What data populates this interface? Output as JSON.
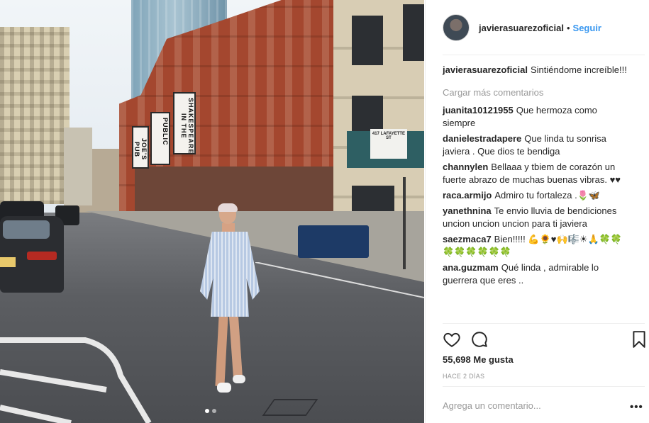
{
  "post": {
    "username": "javierasuarezoficial",
    "follow_label": "Seguir",
    "separator": "•",
    "caption": "Sintiéndome increíble!!!",
    "load_more": "Cargar más comentarios",
    "comments": [
      {
        "user": "juanita10121955",
        "text": "Que hermoza como siempre"
      },
      {
        "user": "danielestradapere",
        "text": "Que linda tu sonrisa javiera . Que dios te bendiga"
      },
      {
        "user": "channylen",
        "text": "Bellaaa y tbiem de corazón un fuerte abrazo de muchas buenas vibras. ♥♥"
      },
      {
        "user": "raca.armijo",
        "text": "Admiro tu fortaleza .🌷🦋"
      },
      {
        "user": "yanethnina",
        "text": "Te envio lluvia de bendiciones uncion uncion uncion para ti javiera"
      },
      {
        "user": "saezmaca7",
        "text": "Bien!!!!! 💪🌻♥🙌🎼☀🙏🍀🍀🍀🍀🍀🍀🍀🍀"
      },
      {
        "user": "ana.guzmam",
        "text": "Qué linda , admirable lo guerrera que eres .."
      }
    ],
    "likes": "55,698 Me gusta",
    "date": "HACE 2 DÍAS",
    "add_comment_placeholder": "Agrega un comentario...",
    "more_options": "•••"
  },
  "photo": {
    "banners": [
      "PUBLIC",
      "SHAKESPEARE IN THE",
      "JOE'S PUB"
    ],
    "street_sign": "417 LAFAYETTE ST",
    "carousel_dots": 2,
    "carousel_active": 0
  },
  "colors": {
    "accent": "#3897f0",
    "muted": "#999999",
    "text": "#262626",
    "border": "#efefef"
  },
  "icons": {
    "like": "heart-icon",
    "comment": "speech-bubble-icon",
    "save": "bookmark-icon"
  }
}
